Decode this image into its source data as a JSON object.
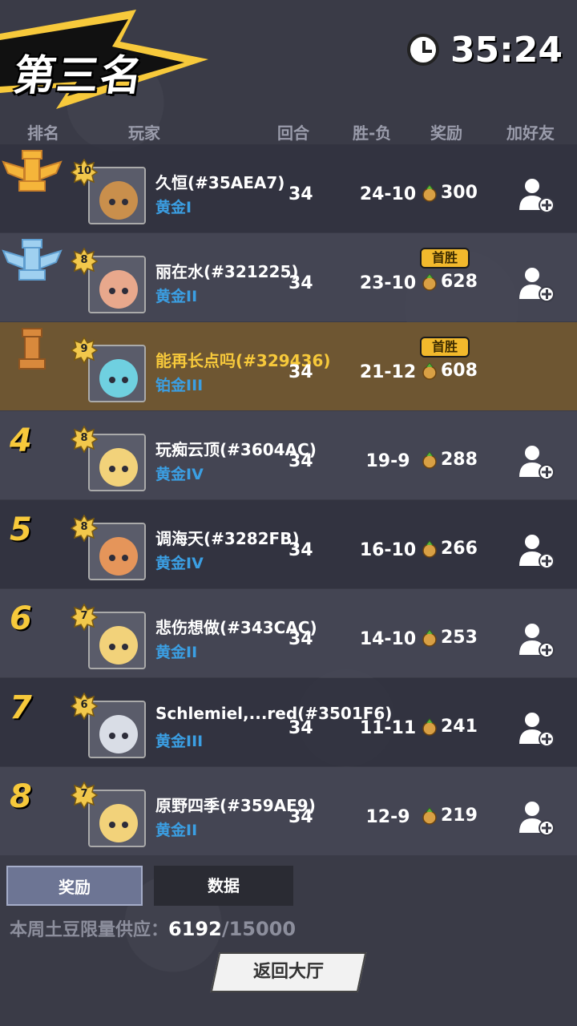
{
  "header": {
    "placement": "第三名",
    "timer": "35:24"
  },
  "columns": {
    "rank": "排名",
    "player": "玩家",
    "rounds": "回合",
    "winloss": "胜-负",
    "reward": "奖励",
    "add_friend": "加好友"
  },
  "players": [
    {
      "rank": "1",
      "rank_icon": "gold-rook-icon",
      "level": "10",
      "name": "久恒(#35AEA7)",
      "tier": "黄金I",
      "rounds": "34",
      "winloss": "24-10",
      "reward": "300",
      "first_win": "",
      "self": false,
      "avatar_color": "#c98f4c"
    },
    {
      "rank": "2",
      "rank_icon": "silver-rook-icon",
      "level": "8",
      "name": "丽在水(#321225)",
      "tier": "黄金II",
      "rounds": "34",
      "winloss": "23-10",
      "reward": "628",
      "first_win": "首胜",
      "self": false,
      "avatar_color": "#e8a88c"
    },
    {
      "rank": "3",
      "rank_icon": "bronze-rook-icon",
      "level": "9",
      "name": "能再长点吗(#329436)",
      "tier": "铂金III",
      "rounds": "34",
      "winloss": "21-12",
      "reward": "608",
      "first_win": "首胜",
      "self": true,
      "avatar_color": "#6fd0e0"
    },
    {
      "rank": "4",
      "rank_icon": "",
      "level": "8",
      "name": "玩痴云顶(#3604AC)",
      "tier": "黄金IV",
      "rounds": "34",
      "winloss": "19-9",
      "reward": "288",
      "first_win": "",
      "self": false,
      "avatar_color": "#f2d27a"
    },
    {
      "rank": "5",
      "rank_icon": "",
      "level": "8",
      "name": "调海天(#3282FB)",
      "tier": "黄金IV",
      "rounds": "34",
      "winloss": "16-10",
      "reward": "266",
      "first_win": "",
      "self": false,
      "avatar_color": "#e5955a"
    },
    {
      "rank": "6",
      "rank_icon": "",
      "level": "7",
      "name": "悲伤想做(#343CAC)",
      "tier": "黄金II",
      "rounds": "34",
      "winloss": "14-10",
      "reward": "253",
      "first_win": "",
      "self": false,
      "avatar_color": "#f2d27a"
    },
    {
      "rank": "7",
      "rank_icon": "",
      "level": "6",
      "name": "Schlemiel,...red(#3501F6)",
      "tier": "黄金III",
      "rounds": "34",
      "winloss": "11-11",
      "reward": "241",
      "first_win": "",
      "self": false,
      "avatar_color": "#d9dde6"
    },
    {
      "rank": "8",
      "rank_icon": "",
      "level": "7",
      "name": "原野四季(#359AE9)",
      "tier": "黄金II",
      "rounds": "34",
      "winloss": "12-9",
      "reward": "219",
      "first_win": "",
      "self": false,
      "avatar_color": "#f2d27a"
    }
  ],
  "tabs": {
    "reward": "奖励",
    "data": "数据"
  },
  "supply": {
    "label": "本周土豆限量供应：",
    "current": "6192",
    "max": "/15000"
  },
  "back_button": "返回大厅",
  "colors": {
    "accent_yellow": "#f7c93b",
    "tier_blue": "#3b9fe3",
    "self_row": "#6e5632"
  }
}
